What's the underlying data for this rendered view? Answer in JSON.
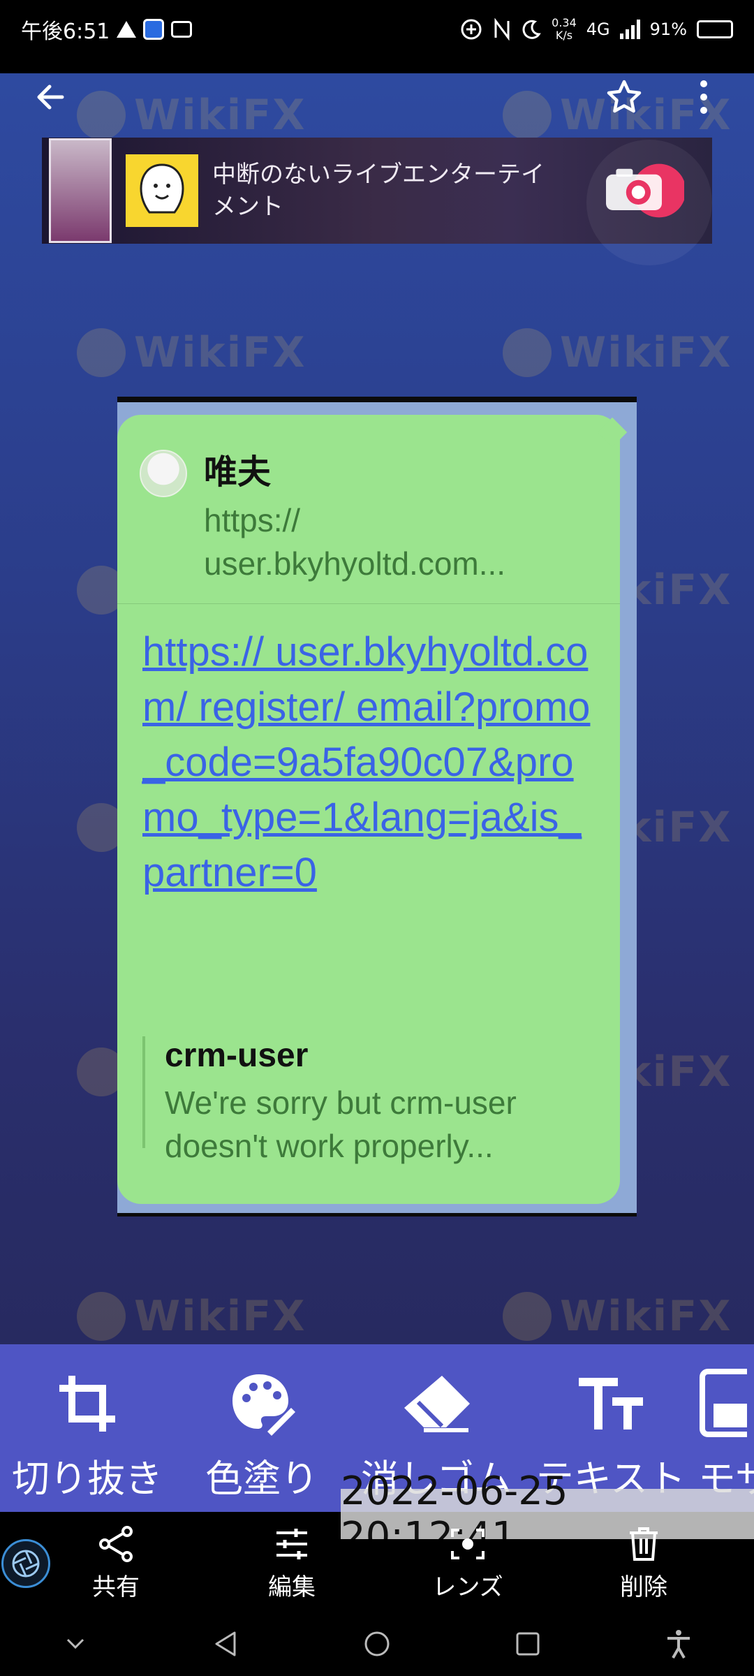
{
  "status_bar": {
    "time": "午後6:51",
    "net_speed_value": "0.34",
    "net_speed_unit": "K/s",
    "network": "4G",
    "battery": "91%",
    "battery_level": 0.91
  },
  "ad": {
    "text": "中断のないライブエンターテイメント"
  },
  "chat": {
    "reply_name": "唯夫",
    "reply_url": "https:// user.bkyhyoltd.com...",
    "link": "https:// user.bkyhyoltd.com/ register/ email?promo_code=9a5fa90c07&promo_type=1&lang=ja&is_partner=0",
    "preview_title": "crm-user",
    "preview_desc": "We're sorry but crm-user doesn't work properly..."
  },
  "watermark_text": "WikiFX",
  "tools": [
    {
      "label": "切り抜き",
      "icon": "crop-icon"
    },
    {
      "label": "色塗り",
      "icon": "palette-icon"
    },
    {
      "label": "消しゴム",
      "icon": "eraser-icon"
    },
    {
      "label": "テキスト",
      "icon": "text-icon"
    },
    {
      "label": "モザ",
      "icon": "mosaic-icon"
    }
  ],
  "timestamp": "2022-06-25 20:12:41",
  "actions": [
    {
      "label": "共有",
      "icon": "share-icon"
    },
    {
      "label": "編集",
      "icon": "edit-sliders-icon"
    },
    {
      "label": "レンズ",
      "icon": "lens-icon"
    },
    {
      "label": "削除",
      "icon": "delete-icon"
    }
  ],
  "colors": {
    "bubble": "#9be48e",
    "link": "#3a63e6",
    "toolbar": "#4f55c4"
  }
}
